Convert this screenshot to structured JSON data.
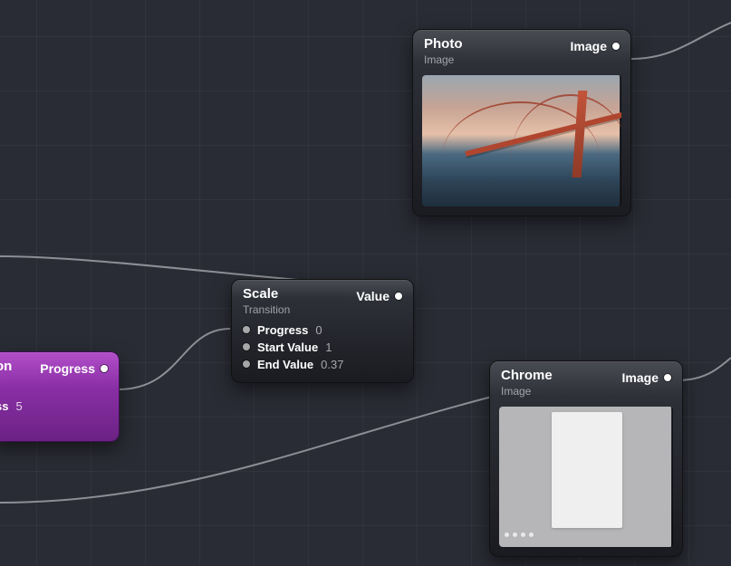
{
  "nodes": {
    "photo": {
      "title": "Photo",
      "subtitle": "Image",
      "output_label": "Image"
    },
    "scale": {
      "title": "Scale",
      "subtitle": "Transition",
      "output_label": "Value",
      "params": {
        "progress": {
          "label": "Progress",
          "value": "0"
        },
        "start": {
          "label": "Start Value",
          "value": "1"
        },
        "end": {
          "label": "End Value",
          "value": "0.37"
        }
      }
    },
    "chrome": {
      "title": "Chrome",
      "subtitle": "Image",
      "output_label": "Image"
    },
    "purple": {
      "title_suffix": "on",
      "output_label": "Progress",
      "param_suffix_label": "ss",
      "param_suffix_value": "5"
    }
  }
}
